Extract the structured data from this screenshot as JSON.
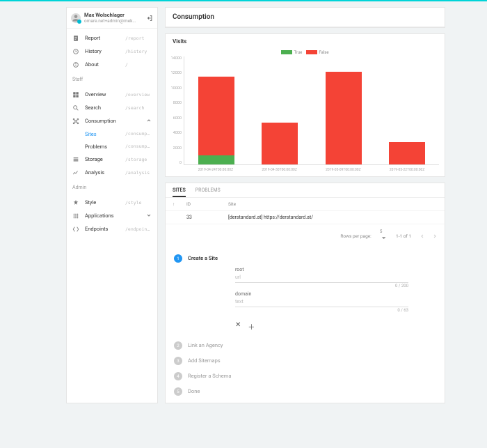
{
  "user": {
    "name": "Max Wolschlager",
    "email": "omare.net+admin@mek..."
  },
  "nav": {
    "items": [
      {
        "label": "Report",
        "path": "/report"
      },
      {
        "label": "History",
        "path": "/history"
      },
      {
        "label": "About",
        "path": "/"
      }
    ],
    "staff_hdr": "Staff",
    "staff": [
      {
        "label": "Overview",
        "path": "/overview"
      },
      {
        "label": "Search",
        "path": "/search"
      }
    ],
    "consumption": {
      "label": "Consumption",
      "sub": [
        {
          "label": "Sites",
          "path": "/consumption..."
        },
        {
          "label": "Problems",
          "path": "/consumption..."
        }
      ]
    },
    "more": [
      {
        "label": "Storage",
        "path": "/storage"
      },
      {
        "label": "Analysis",
        "path": "/analysis"
      }
    ],
    "admin_hdr": "Admin",
    "admin": [
      {
        "label": "Style",
        "path": "/style"
      },
      {
        "label": "Applications",
        "path": ""
      },
      {
        "label": "Endpoints",
        "path": "/endpoints"
      }
    ]
  },
  "page": {
    "title": "Consumption"
  },
  "chart": {
    "title": "Visits",
    "legend": {
      "true": "True",
      "false": "False"
    }
  },
  "chart_data": {
    "type": "bar",
    "categories": [
      "2019-04-24T00:00:00Z",
      "2019-04-30T00:00:00Z",
      "2019-05-09T00:00:00Z",
      "2019-05-22T00:00:00Z"
    ],
    "series": [
      {
        "name": "True",
        "values": [
          1200,
          0,
          0,
          0
        ]
      },
      {
        "name": "False",
        "values": [
          10200,
          5400,
          12000,
          2900
        ]
      }
    ],
    "ylabel": "",
    "xlabel": "",
    "ylim": [
      0,
      14000
    ],
    "yticks": [
      0,
      2000,
      4000,
      6000,
      8000,
      10000,
      12000,
      14000
    ]
  },
  "tabs": {
    "sites": "SITES",
    "problems": "PROBLEMS"
  },
  "table": {
    "sort_icon": "↑",
    "id_hdr": "ID",
    "site_hdr": "Site",
    "rows": [
      {
        "id": "33",
        "site": "[derstandard.at] https://derstandard.at/"
      }
    ],
    "rpp_label": "Rows per page:",
    "rpp_value": "5",
    "range": "1-1 of 1"
  },
  "stepper": {
    "s1": {
      "title": "Create a Site",
      "root": {
        "label": "root",
        "value": "url",
        "count": "0 / 200"
      },
      "domain": {
        "label": "domain",
        "value": "text",
        "count": "0 / 63"
      }
    },
    "s2": "Link an Agency",
    "s3": "Add Sitemaps",
    "s4": "Register a Schema",
    "s5": "Done"
  }
}
